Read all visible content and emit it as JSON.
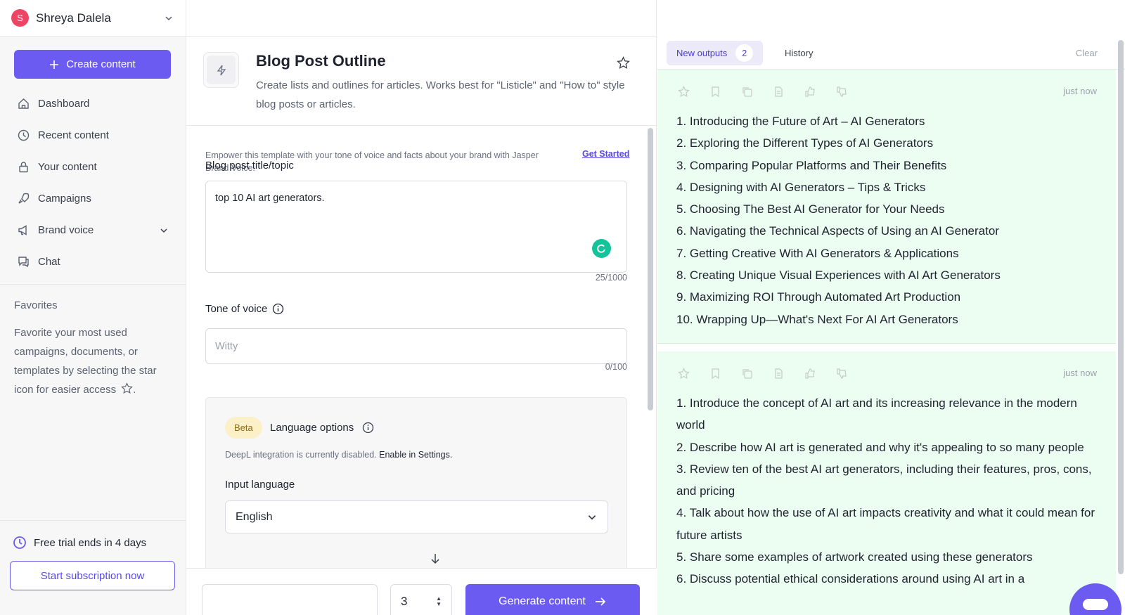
{
  "user": {
    "initial": "S",
    "name": "Shreya Dalela",
    "avatar_color": "#ef4565"
  },
  "sidebar": {
    "create_label": "Create content",
    "items": [
      {
        "label": "Dashboard",
        "icon": "home-icon"
      },
      {
        "label": "Recent content",
        "icon": "clock-icon"
      },
      {
        "label": "Your content",
        "icon": "lock-icon"
      },
      {
        "label": "Campaigns",
        "icon": "rocket-icon"
      },
      {
        "label": "Brand voice",
        "icon": "megaphone-icon"
      },
      {
        "label": "Chat",
        "icon": "chat-icon"
      }
    ],
    "favorites_title": "Favorites",
    "favorites_text": "Favorite your most used campaigns, documents, or templates by selecting the star icon for easier access",
    "favorites_period": ".",
    "trial_text": "Free trial ends in 4 days",
    "subscription_label": "Start subscription now"
  },
  "template": {
    "title": "Blog Post Outline",
    "description": "Create lists and outlines for articles. Works best for \"Listicle\" and \"How to\" style blog posts or articles."
  },
  "form": {
    "empower_text": "Empower this template with your tone of voice and facts about your brand with Jasper Brand Voice.",
    "get_started": "Get Started",
    "topic_label": "Blog post title/topic",
    "topic_value": "top 10 AI art generators.",
    "topic_counter": "25/1000",
    "tone_label": "Tone of voice",
    "tone_placeholder": "Witty",
    "tone_counter": "0/100",
    "beta_label": "Beta",
    "language_options_label": "Language options",
    "deepl_text": "DeepL integration is currently disabled.",
    "deepl_link": "Enable in Settings.",
    "input_language_label": "Input language",
    "input_language_value": "English"
  },
  "bottom": {
    "output_count": "3",
    "generate_label": "Generate content"
  },
  "outputs": {
    "new_tab": "New outputs",
    "new_count": "2",
    "history_tab": "History",
    "clear": "Clear",
    "cards": [
      {
        "time": "just now",
        "lines": [
          "1. Introducing the Future of Art – AI Generators",
          "2. Exploring the Different Types of AI Generators",
          "3. Comparing Popular Platforms and Their Benefits",
          "4. Designing with AI Generators – Tips & Tricks",
          "5. Choosing The Best AI Generator for Your Needs",
          "6. Navigating the Technical Aspects of Using an AI Generator",
          "7. Getting Creative With AI Generators & Applications",
          "8. Creating Unique Visual Experiences with AI Art Generators",
          "9. Maximizing ROI Through Automated Art Production",
          "10. Wrapping Up—What's Next For AI Art Generators"
        ]
      },
      {
        "time": "just now",
        "lines": [
          "1. Introduce the concept of AI art and its increasing relevance in the modern world",
          "2. Describe how AI art is generated and why it's appealing to so many people",
          "3. Review ten of the best AI art generators, including their features, pros, cons, and pricing",
          "4. Talk about how the use of AI art impacts creativity and what it could mean for future artists",
          "5. Share some examples of artwork created using these generators",
          "6. Discuss potential ethical considerations around using AI art in a"
        ]
      }
    ]
  },
  "colors": {
    "accent": "#6b5bf1",
    "output_bg": "#ecfdf1",
    "beta_bg": "#fbf0c8",
    "grammarly": "#15c39a"
  }
}
